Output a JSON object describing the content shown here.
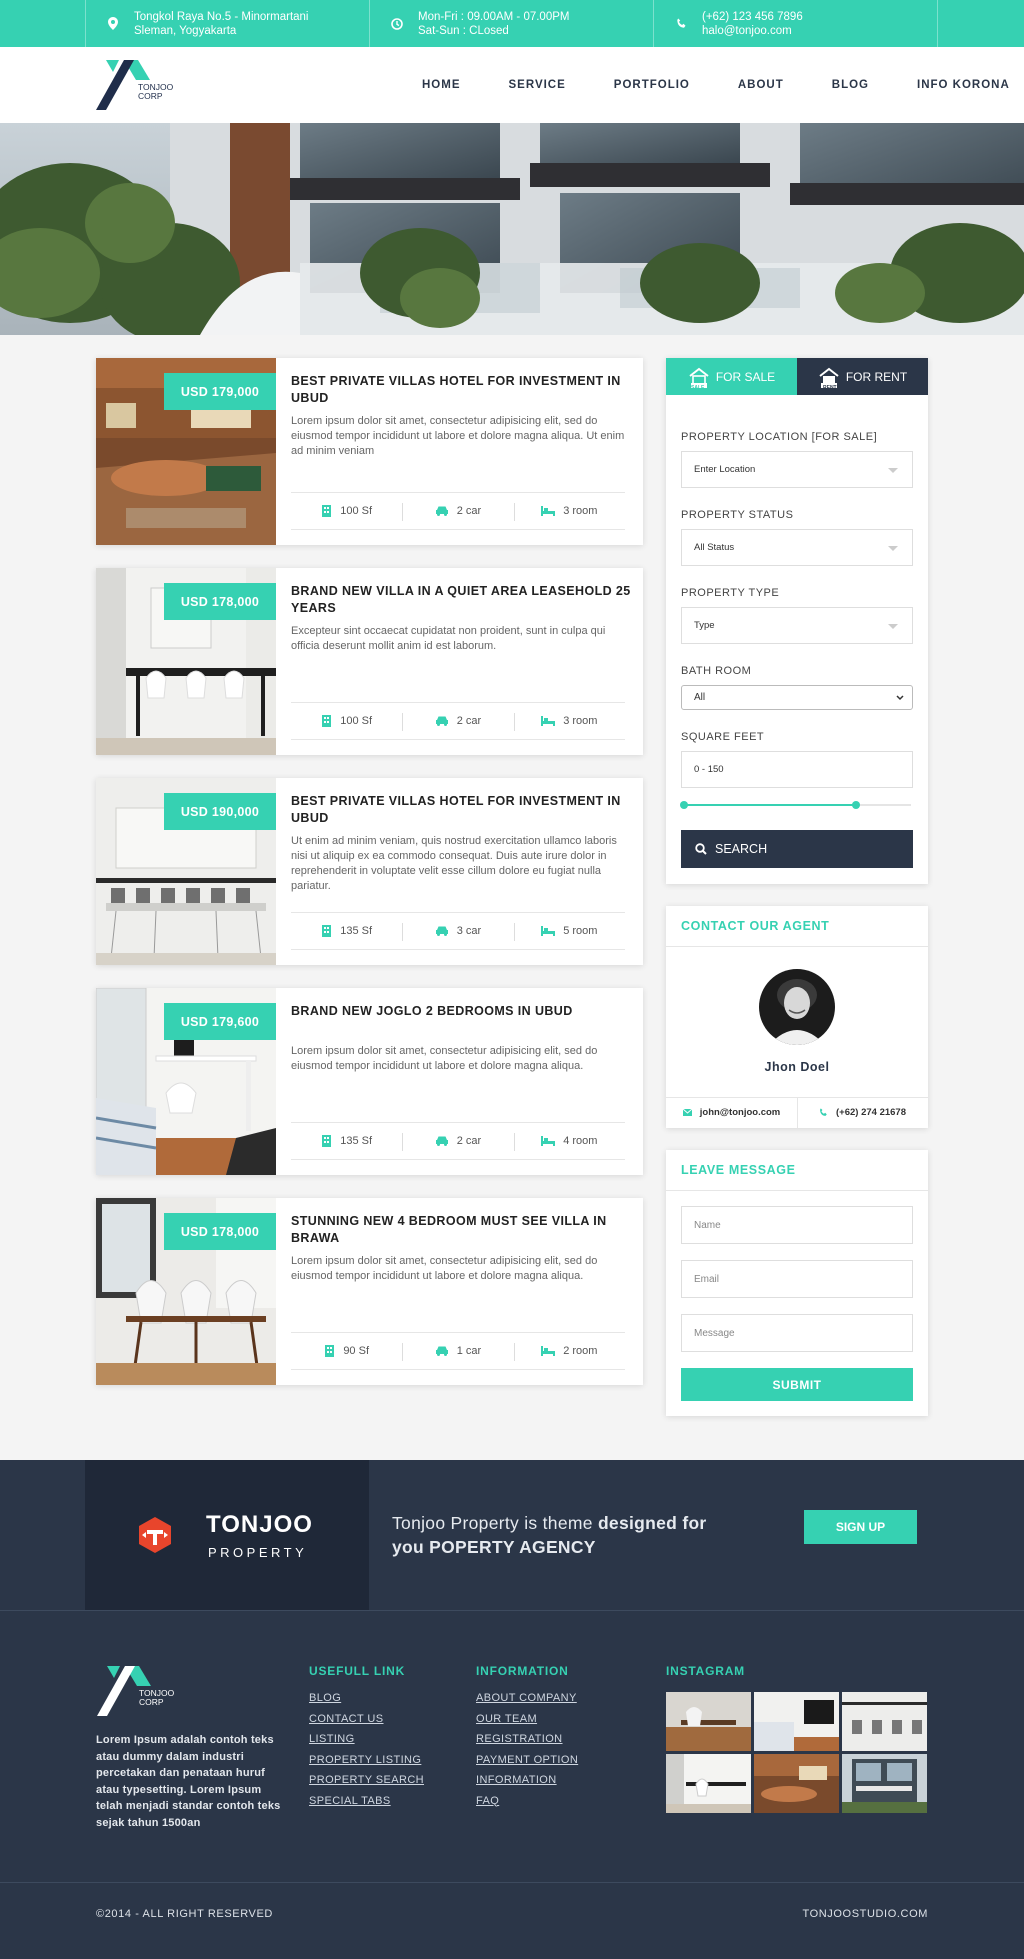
{
  "topbar": {
    "address_line1": "Tongkol Raya No.5 - Minormartani",
    "address_line2": "Sleman, Yogyakarta",
    "hours_line1": "Mon-Fri : 09.00AM - 07.00PM",
    "hours_line2": "Sat-Sun : CLosed",
    "phone": "(+62) 123 456 7896",
    "email": "halo@tonjoo.com"
  },
  "logo": {
    "line1": "TONJOO",
    "line2": "CORP"
  },
  "nav": [
    "HOME",
    "SERVICE",
    "PORTFOLIO",
    "ABOUT",
    "BLOG",
    "INFO KORONA"
  ],
  "listings": [
    {
      "price": "USD 179,000",
      "title": "BEST PRIVATE VILLAS HOTEL FOR INVESTMENT IN UBUD",
      "desc": "Lorem ipsum dolor sit amet, consectetur adipisicing elit, sed do eiusmod tempor incididunt ut labore et dolore magna aliqua. Ut enim ad minim veniam",
      "area": "100 Sf",
      "car": "2 car",
      "room": "3 room"
    },
    {
      "price": "USD 178,000",
      "title": "BRAND NEW VILLA IN A QUIET AREA LEASEHOLD 25 YEARS",
      "desc": "Excepteur sint occaecat cupidatat non proident, sunt in culpa qui officia deserunt mollit anim id est laborum.",
      "area": "100 Sf",
      "car": "2 car",
      "room": "3 room"
    },
    {
      "price": "USD 190,000",
      "title": "BEST PRIVATE VILLAS HOTEL FOR INVESTMENT IN UBUD",
      "desc": "Ut enim ad minim veniam, quis nostrud exercitation ullamco laboris nisi ut aliquip ex ea commodo consequat. Duis aute irure dolor in reprehenderit in voluptate velit esse cillum dolore eu fugiat nulla pariatur.",
      "area": "135 Sf",
      "car": "3 car",
      "room": "5 room"
    },
    {
      "price": "USD 179,600",
      "title": "BRAND NEW JOGLO 2 BEDROOMS IN UBUD",
      "desc": "Lorem ipsum dolor sit amet, consectetur adipisicing elit, sed do eiusmod tempor incididunt ut labore et dolore magna aliqua.",
      "area": "135 Sf",
      "car": "2 car",
      "room": "4 room"
    },
    {
      "price": "USD 178,000",
      "title": "STUNNING NEW 4 BEDROOM MUST SEE VILLA IN BRAWA",
      "desc": "Lorem ipsum dolor sit amet, consectetur adipisicing elit, sed do eiusmod tempor incididunt ut labore et dolore magna aliqua.",
      "area": "90 Sf",
      "car": "1 car",
      "room": "2 room"
    }
  ],
  "search": {
    "tab_sale": "FOR SALE",
    "tab_rent": "FOR RENT",
    "tab_sale_badge": "SALE",
    "tab_rent_badge": "RENT",
    "location_label": "PROPERTY LOCATION [FOR SALE]",
    "location_value": "Enter Location",
    "status_label": "PROPERTY STATUS",
    "status_value": "All Status",
    "type_label": "PROPERTY TYPE",
    "type_value": "Type",
    "bath_label": "BATH ROOM",
    "bath_value": "All",
    "sqft_label": "SQUARE FEET",
    "sqft_value": "0 - 150",
    "sqft_slider_fraction": 0.76,
    "search_button": "SEARCH"
  },
  "agent": {
    "title": "CONTACT OUR AGENT",
    "name": "Jhon Doel",
    "email": "john@tonjoo.com",
    "phone": "(+62) 274 21678"
  },
  "message": {
    "title": "LEAVE MESSAGE",
    "name_placeholder": "Name",
    "email_placeholder": "Email",
    "message_placeholder": "Message",
    "submit": "SUBMIT"
  },
  "banner": {
    "brand": "TONJOO",
    "sub": "PROPERTY",
    "text_plain": "Tonjoo Property is theme ",
    "text_bold1": "designed for",
    "text_bold2": "you POPERTY AGENCY",
    "signup": "SIGN UP"
  },
  "footer": {
    "about": "Lorem Ipsum adalah contoh teks atau dummy dalam industri percetakan dan penataan huruf atau typesetting. Lorem Ipsum telah menjadi standar contoh teks sejak tahun 1500an",
    "useful_title": "USEFULL LINK",
    "useful_links": [
      "BLOG",
      "CONTACT US",
      "LISTING",
      "PROPERTY LISTING",
      "PROPERTY SEARCH",
      "SPECIAL TABS"
    ],
    "info_title": "INFORMATION",
    "info_links": [
      "ABOUT COMPANY",
      "OUR TEAM",
      "REGISTRATION",
      "PAYMENT OPTION",
      "INFORMATION",
      "FAQ"
    ],
    "instagram_title": "INSTAGRAM",
    "copyright": "©2014 - ALL RIGHT RESERVED",
    "site": "TONJOOSTUDIO.COM"
  },
  "colors": {
    "accent": "#36d1b2",
    "dark": "#2b3648",
    "darker": "#1f2838",
    "brand_red": "#e8452c"
  }
}
